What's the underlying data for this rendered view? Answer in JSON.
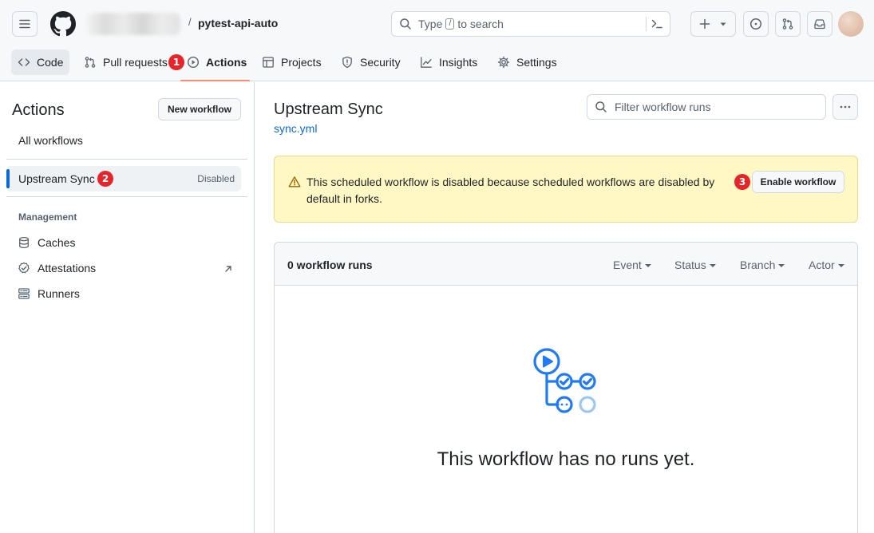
{
  "header": {
    "repo_name": "pytest-api-auto",
    "slash": "/",
    "search": {
      "prefix": "Type",
      "key": "/",
      "suffix": "to search"
    }
  },
  "repo_nav": {
    "code": "Code",
    "pull_requests": "Pull requests",
    "actions": "Actions",
    "projects": "Projects",
    "security": "Security",
    "insights": "Insights",
    "settings": "Settings"
  },
  "markers": {
    "m1": "1",
    "m2": "2",
    "m3": "3"
  },
  "sidebar": {
    "title": "Actions",
    "new_workflow": "New workflow",
    "all_workflows": "All workflows",
    "active_workflow": {
      "label": "Upstream Sync",
      "status": "Disabled"
    },
    "management_heading": "Management",
    "management_items": [
      "Caches",
      "Attestations",
      "Runners"
    ]
  },
  "main": {
    "workflow_title": "Upstream Sync",
    "workflow_file": "sync.yml",
    "filter_placeholder": "Filter workflow runs",
    "flash_message": "This scheduled workflow is disabled because scheduled workflows are disabled by default in forks.",
    "enable_button": "Enable workflow",
    "runs": {
      "count_label": "0 workflow runs",
      "filters": [
        "Event",
        "Status",
        "Branch",
        "Actor"
      ]
    },
    "blankslate_title": "This workflow has no runs yet."
  },
  "colors": {
    "accent_link": "#0969da",
    "nav_underline": "#fd8c73",
    "flash_bg": "#fff8c5",
    "marker_red": "#e5252a",
    "blankslate_blue": "#1f7bf5"
  }
}
